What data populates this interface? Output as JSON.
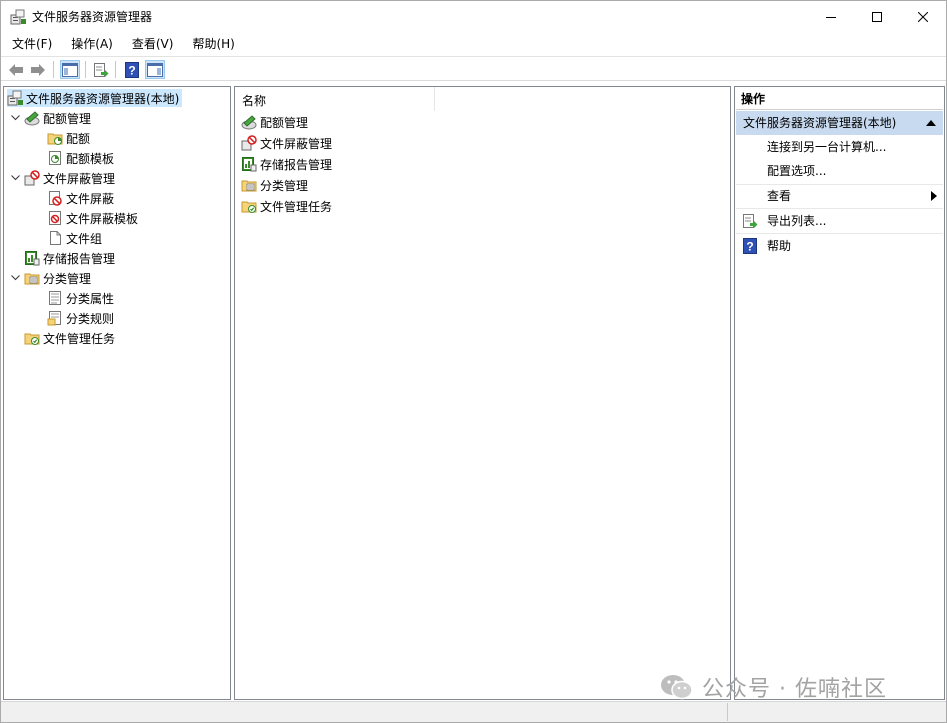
{
  "window": {
    "title": "文件服务器资源管理器"
  },
  "menu": {
    "items": [
      "文件(F)",
      "操作(A)",
      "查看(V)",
      "帮助(H)"
    ]
  },
  "tree": {
    "root": "文件服务器资源管理器(本地)",
    "quota_mgmt": "配额管理",
    "quota": "配额",
    "quota_template": "配额模板",
    "screen_mgmt": "文件屏蔽管理",
    "screen": "文件屏蔽",
    "screen_template": "文件屏蔽模板",
    "file_group": "文件组",
    "storage_report": "存储报告管理",
    "classification": "分类管理",
    "class_props": "分类属性",
    "class_rules": "分类规则",
    "file_tasks": "文件管理任务"
  },
  "list": {
    "column_name": "名称",
    "items": [
      "配额管理",
      "文件屏蔽管理",
      "存储报告管理",
      "分类管理",
      "文件管理任务"
    ]
  },
  "actions": {
    "header": "操作",
    "section": "文件服务器资源管理器(本地)",
    "connect": "连接到另一台计算机...",
    "configure": "配置选项...",
    "view": "查看",
    "export": "导出列表...",
    "help": "帮助"
  },
  "watermark": {
    "text": "公众号 · 佐喃社区"
  },
  "colors": {
    "selection": "#cce8ff",
    "action_section": "#c8daf0",
    "pane_border": "#828790"
  }
}
